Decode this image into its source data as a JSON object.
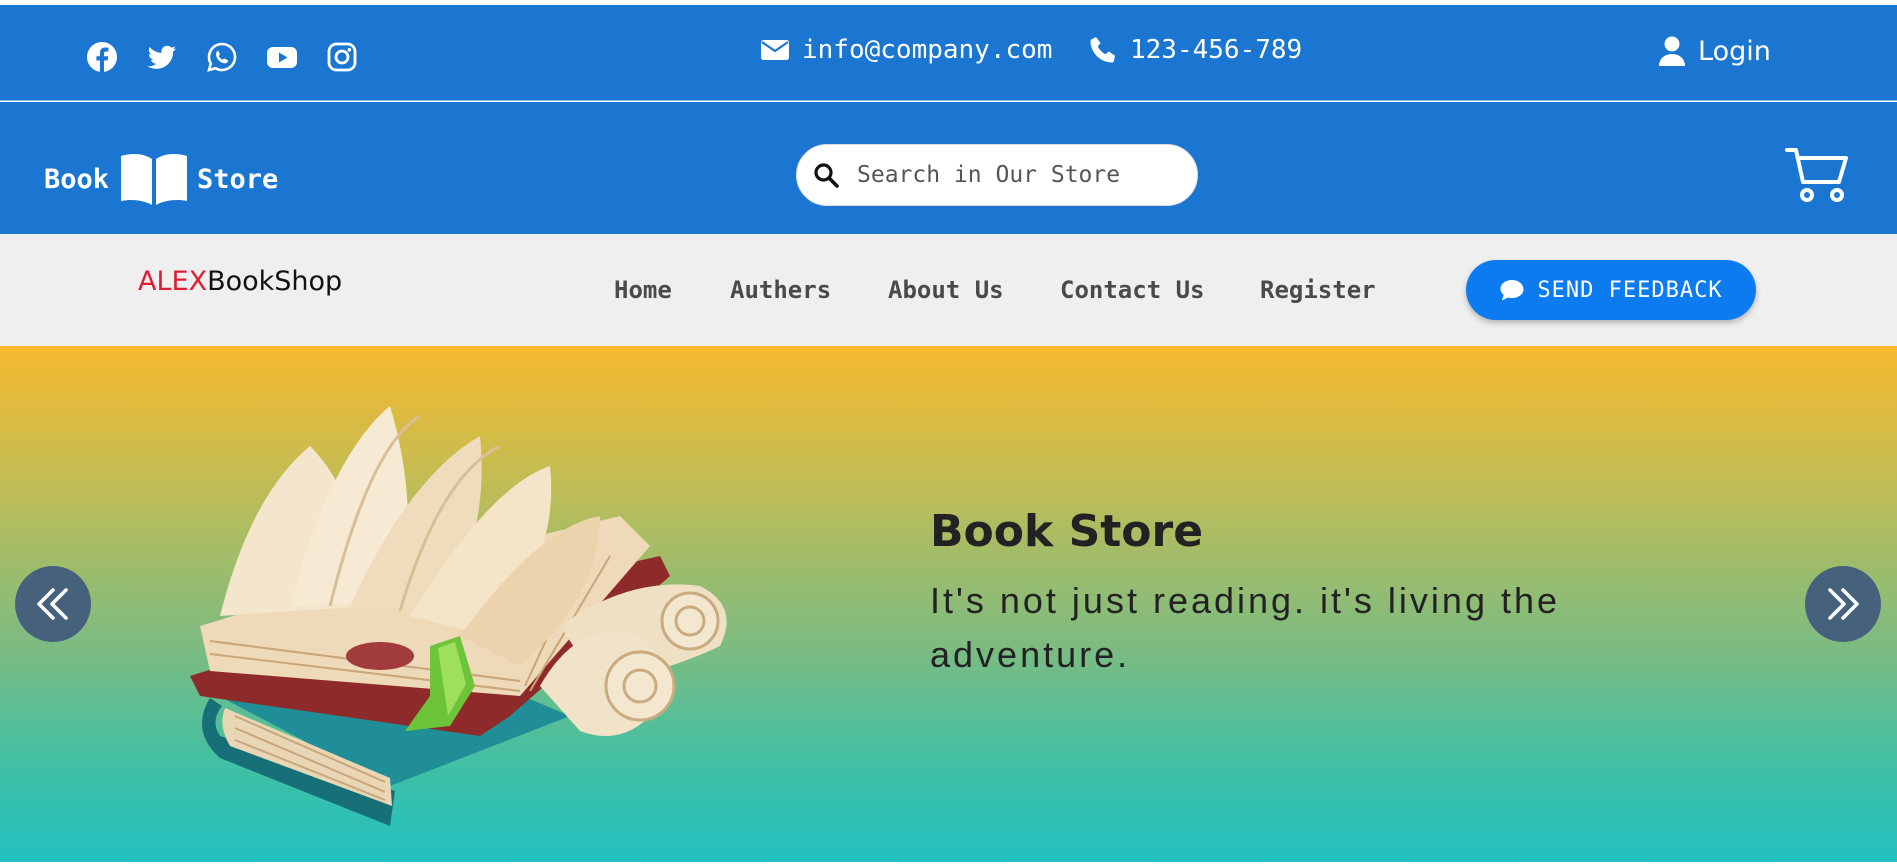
{
  "topbar": {
    "social_icons": [
      "facebook-icon",
      "twitter-icon",
      "whatsapp-icon",
      "youtube-icon",
      "instagram-icon"
    ],
    "email": "info@company.com",
    "phone": "123-456-789",
    "login_label": "Login"
  },
  "header": {
    "logo_left": "Book",
    "logo_right": "Store",
    "search_placeholder": "Search in Our Store"
  },
  "nav": {
    "brand_accent": "ALEX",
    "brand_rest": "BookShop",
    "items": [
      {
        "label": "Home"
      },
      {
        "label": "Authers"
      },
      {
        "label": "About Us"
      },
      {
        "label": "Contact Us"
      },
      {
        "label": "Register"
      }
    ],
    "feedback_label": "SEND FEEDBACK"
  },
  "hero": {
    "title": "Book Store",
    "subtitle": "It's not just reading. it's living the adventure."
  },
  "colors": {
    "primary": "#1b76d2",
    "nav_bg": "#efefef",
    "brand_accent": "#dc1e35",
    "feedback_button": "#0d7bf0",
    "hero_gradient_top": "#f8b92e",
    "hero_gradient_bottom": "#22c0c0",
    "slider_arrow": "#45617b"
  }
}
